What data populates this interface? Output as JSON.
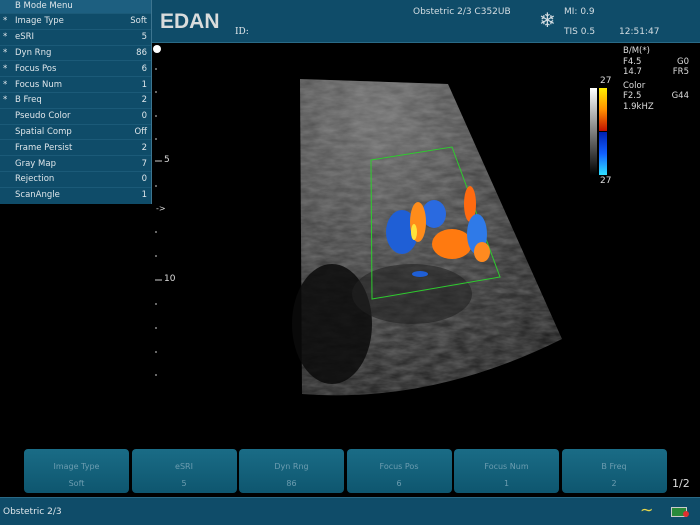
{
  "menu": {
    "title": "B Mode Menu",
    "items": [
      {
        "star": "*",
        "label": "Image Type",
        "value": "Soft"
      },
      {
        "star": "*",
        "label": "eSRI",
        "value": "5"
      },
      {
        "star": "*",
        "label": "Dyn Rng",
        "value": "86"
      },
      {
        "star": "*",
        "label": "Focus Pos",
        "value": "6"
      },
      {
        "star": "*",
        "label": "Focus Num",
        "value": "1"
      },
      {
        "star": "*",
        "label": "B Freq",
        "value": "2"
      },
      {
        "star": "",
        "label": "Pseudo Color",
        "value": "0"
      },
      {
        "star": "",
        "label": "Spatial Comp",
        "value": "Off"
      },
      {
        "star": "",
        "label": "Frame Persist",
        "value": "2"
      },
      {
        "star": "",
        "label": "Gray Map",
        "value": "7"
      },
      {
        "star": "",
        "label": "Rejection",
        "value": "0"
      },
      {
        "star": "",
        "label": "ScanAngle",
        "value": "1"
      }
    ]
  },
  "header": {
    "logo": "EDAN",
    "id_label": "ID:",
    "exam": "Obstetric 2/3 C352UB",
    "freeze_icon": "snowflake-icon",
    "mi": "MI: 0.9",
    "tis": "TIS 0.5",
    "time": "12:51:47"
  },
  "depth_scale": {
    "mark5": "5",
    "focus": "->",
    "mark10": "10"
  },
  "color_bar": {
    "top": "27",
    "bottom": "27"
  },
  "params": {
    "bm_title": "B/M(*)",
    "f": "F4.5",
    "g": "G0",
    "depth": "14.7",
    "fr": "FR5",
    "color_title": "Color",
    "cf": "F2.5",
    "cg": "G44",
    "prf": "1.9kHZ"
  },
  "softkeys": [
    {
      "label": "Image Type",
      "value": "Soft"
    },
    {
      "label": "eSRI",
      "value": "5"
    },
    {
      "label": "Dyn Rng",
      "value": "86"
    },
    {
      "label": "Focus Pos",
      "value": "6"
    },
    {
      "label": "Focus Num",
      "value": "1"
    },
    {
      "label": "B Freq",
      "value": "2"
    }
  ],
  "page_indicator": "1/2",
  "status": {
    "exam": "Obstetric 2/3",
    "wave_icon": "wave-icon",
    "battery_icon": "battery-icon"
  }
}
